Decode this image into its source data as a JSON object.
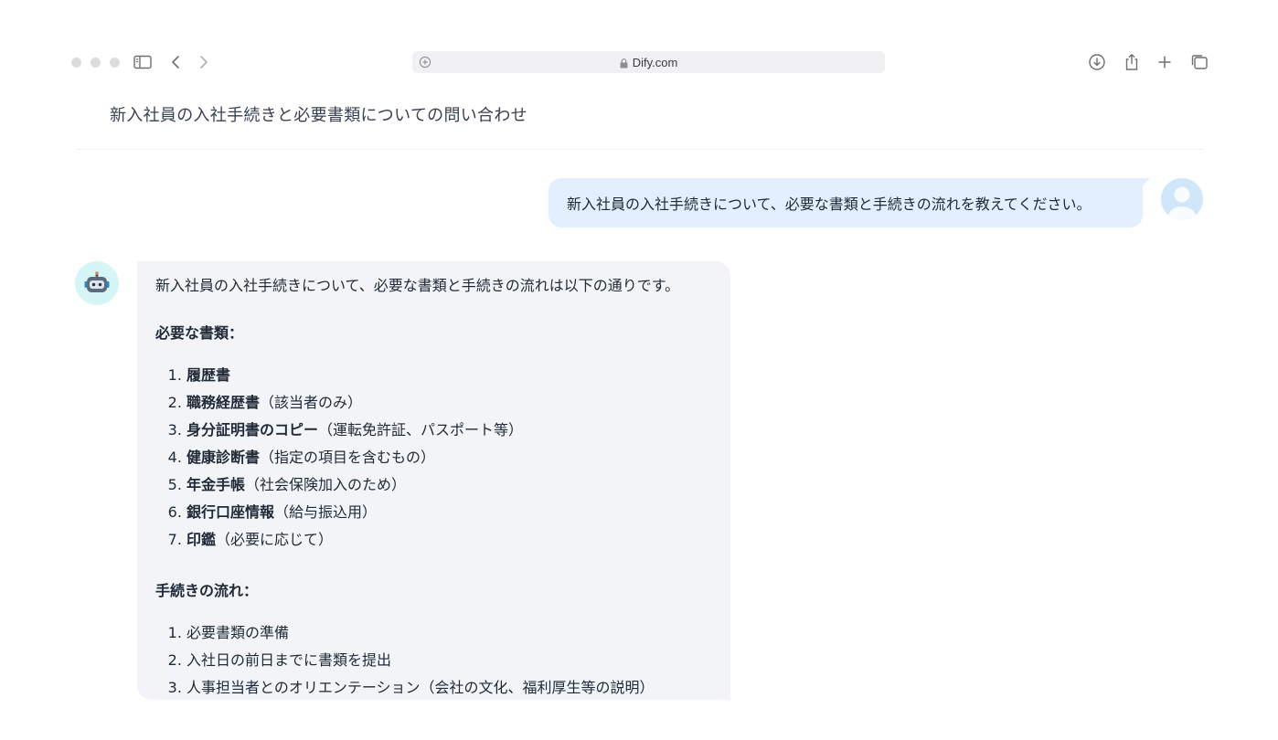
{
  "browser": {
    "url": "Dify.com"
  },
  "conversation": {
    "title": "新入社員の入社手続きと必要書類についての問い合わせ"
  },
  "user_message": {
    "text": "新入社員の入社手続きについて、必要な書類と手続きの流れを教えてください。"
  },
  "bot_message": {
    "intro": "新入社員の入社手続きについて、必要な書類と手続きの流れは以下の通りです。",
    "documents_heading": "必要な書類：",
    "documents": [
      {
        "name": "履歴書",
        "note": ""
      },
      {
        "name": "職務経歴書",
        "note": "（該当者のみ）"
      },
      {
        "name": "身分証明書のコピー",
        "note": "（運転免許証、パスポート等）"
      },
      {
        "name": "健康診断書",
        "note": "（指定の項目を含むもの）"
      },
      {
        "name": "年金手帳",
        "note": "（社会保険加入のため）"
      },
      {
        "name": "銀行口座情報",
        "note": "（給与振込用）"
      },
      {
        "name": "印鑑",
        "note": "（必要に応じて）"
      }
    ],
    "flow_heading": "手続きの流れ：",
    "flow": [
      "必要書類の準備",
      "入社日の前日までに書類を提出",
      "人事担当者とのオリエンテーション（会社の文化、福利厚生等の説明）"
    ]
  },
  "colors": {
    "user_bubble": "#e1effe",
    "bot_bubble": "#f2f4f7",
    "bot_avatar_bg": "#d5f5f6",
    "user_avatar_bg": "#cfe6fb"
  }
}
